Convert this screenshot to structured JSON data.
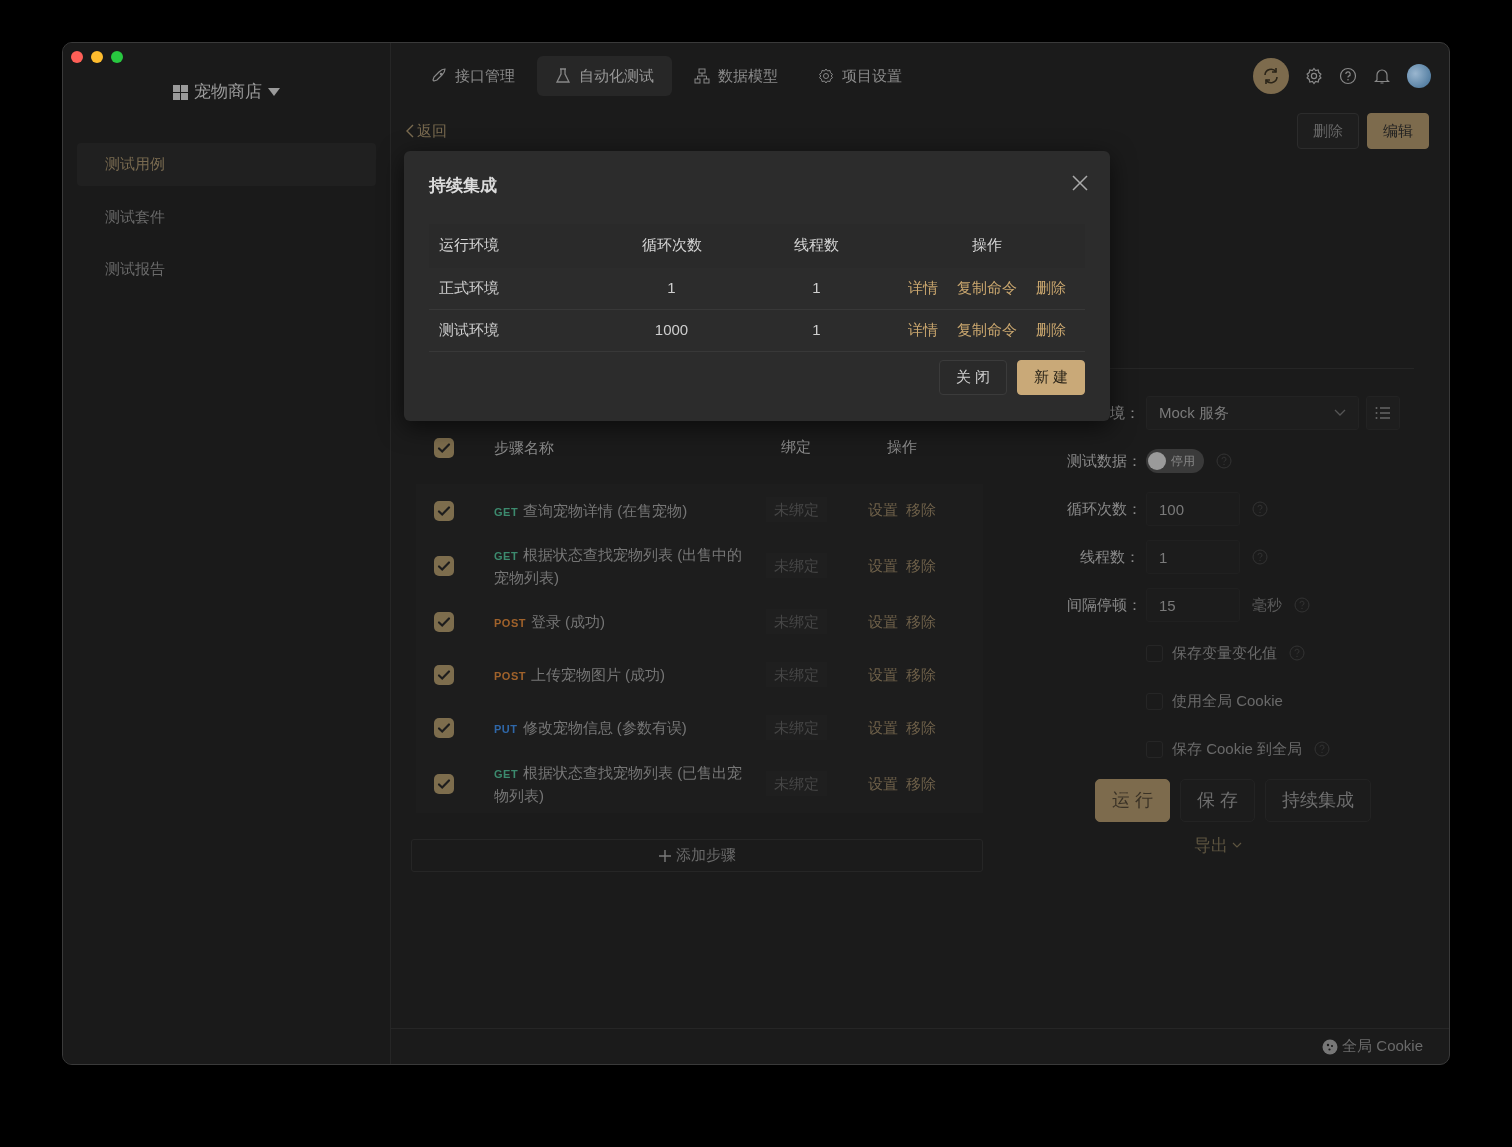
{
  "project": {
    "name": "宠物商店"
  },
  "sidebar": {
    "items": [
      {
        "label": "测试用例",
        "selected": true
      },
      {
        "label": "测试套件",
        "selected": false
      },
      {
        "label": "测试报告",
        "selected": false
      }
    ]
  },
  "tabs": [
    {
      "label": "接口管理",
      "kind": "api",
      "selected": false
    },
    {
      "label": "自动化测试",
      "kind": "test",
      "selected": true
    },
    {
      "label": "数据模型",
      "kind": "model",
      "selected": false
    },
    {
      "label": "项目设置",
      "kind": "settings",
      "selected": false
    }
  ],
  "back_link": "返回",
  "header_buttons": [
    {
      "label": "删除",
      "kind": "default"
    },
    {
      "label": "编辑",
      "kind": "primary"
    }
  ],
  "steps": {
    "columns": [
      "步骤名称",
      "绑定",
      "操作"
    ],
    "all_checked": true,
    "rows": [
      {
        "checked": true,
        "method": "GET",
        "name": "查询宠物详情 (在售宠物)",
        "binding": "未绑定",
        "actions": [
          "设置",
          "移除"
        ]
      },
      {
        "checked": true,
        "method": "GET",
        "name": "根据状态查找宠物列表 (出售中的宠物列表)",
        "binding": "未绑定",
        "actions": [
          "设置",
          "移除"
        ]
      },
      {
        "checked": true,
        "method": "POST",
        "name": "登录 (成功)",
        "binding": "未绑定",
        "actions": [
          "设置",
          "移除"
        ]
      },
      {
        "checked": true,
        "method": "POST",
        "name": "上传宠物图片 (成功)",
        "binding": "未绑定",
        "actions": [
          "设置",
          "移除"
        ]
      },
      {
        "checked": true,
        "method": "PUT",
        "name": "修改宠物信息 (参数有误)",
        "binding": "未绑定",
        "actions": [
          "设置",
          "移除"
        ]
      },
      {
        "checked": true,
        "method": "GET",
        "name": "根据状态查找宠物列表 (已售出宠物列表)",
        "binding": "未绑定",
        "actions": [
          "设置",
          "移除"
        ]
      }
    ],
    "add_step": "添加步骤"
  },
  "form": {
    "fields": [
      {
        "kind": "select",
        "label": "境：",
        "value": "Mock 服务",
        "help": false
      },
      {
        "kind": "switch",
        "label": "测试数据：",
        "on": false,
        "text": "停用",
        "help": true
      },
      {
        "kind": "input",
        "label": "循环次数：",
        "value": "100",
        "help": true
      },
      {
        "kind": "input",
        "label": "线程数：",
        "value": "1",
        "help": true
      },
      {
        "kind": "input",
        "label": "间隔停顿：",
        "value": "15",
        "unit": "毫秒",
        "help": true
      }
    ],
    "options": [
      {
        "label": "保存变量变化值",
        "checked": false,
        "help": true
      },
      {
        "label": "使用全局 Cookie",
        "checked": false,
        "help": false
      },
      {
        "label": "保存 Cookie 到全局",
        "checked": false,
        "help": true
      }
    ],
    "buttons": [
      {
        "label": "运 行",
        "kind": "primary"
      },
      {
        "label": "保 存",
        "kind": "default"
      },
      {
        "label": "持续集成",
        "kind": "default"
      }
    ],
    "export": "导出"
  },
  "status_bar": {
    "cookie": "全局 Cookie"
  },
  "dialog": {
    "title": "持续集成",
    "columns": [
      "运行环境",
      "循环次数",
      "线程数",
      "操作"
    ],
    "rows": [
      {
        "environment": "正式环境",
        "loops": "1",
        "threads": "1",
        "actions": [
          "详情",
          "复制命令",
          "删除"
        ]
      },
      {
        "environment": "测试环境",
        "loops": "1000",
        "threads": "1",
        "actions": [
          "详情",
          "复制命令",
          "删除"
        ]
      }
    ],
    "buttons": [
      {
        "label": "关 闭",
        "kind": "default"
      },
      {
        "label": "新 建",
        "kind": "primary"
      }
    ]
  }
}
